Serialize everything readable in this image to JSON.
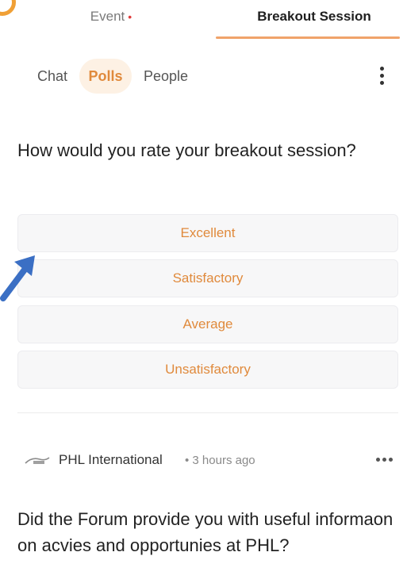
{
  "top_tabs": {
    "event": "Event",
    "event_dot": "•",
    "breakout": "Breakout Session"
  },
  "sub_tabs": {
    "chat": "Chat",
    "polls": "Polls",
    "people": "People"
  },
  "poll": {
    "question": "How would you rate your breakout session?",
    "options": [
      "Excellent",
      "Satisfactory",
      "Average",
      "Unsatisfactory"
    ]
  },
  "post": {
    "org_name": "PHL International",
    "time": "• 3 hours ago",
    "question": "Did the Forum provide you with useful informaon on acvies and opportunies at PHL?"
  },
  "icons": {
    "kebab": "vertical-ellipsis-icon",
    "more": "horizontal-ellipsis-icon",
    "logo": "phl-logo-icon",
    "arrow": "pointer-arrow-icon"
  },
  "colors": {
    "accent": "#e08a3c",
    "accent_bg": "#fdf1e4",
    "underline": "#f0a36a",
    "notification_dot": "#e03a3a",
    "option_bg": "#f7f7f8",
    "arrow": "#3b6fc4"
  }
}
